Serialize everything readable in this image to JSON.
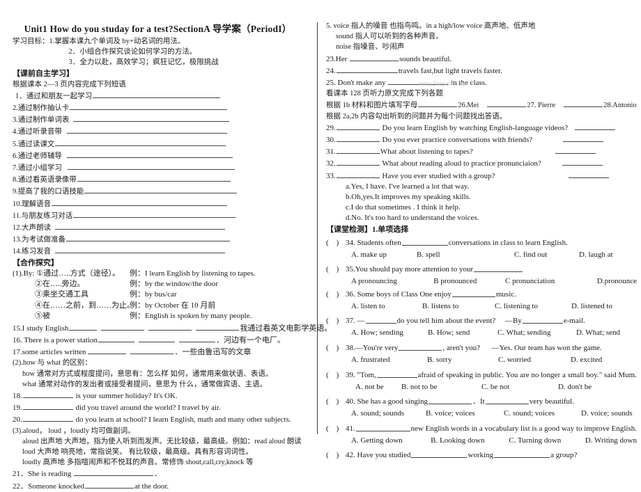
{
  "document": {
    "title": "Unit1 How do you studay for a test?SectionA 导学案（PeriodI）",
    "watermark": "www.1kejian.com"
  },
  "left_column": {
    "goal_label": "学习目标：",
    "goals": [
      "1.掌握本课九个单词及 by+动名词的用法。",
      "2．小组合作探究谈论如何学习的方法。",
      "3．全力以赴，高效学习；疯狂记忆，极限挑战"
    ],
    "section1_heading": "【课前自主学习】",
    "section1_intro": "根据课本 2—3 页内容完成下列短语",
    "phrases": [
      "1．通过和朋友一起学习",
      "2.通过制作抽认卡",
      "3.通过制作单词表",
      "4.通过听录音带",
      "5.通过读课文",
      "6.通过老师辅导",
      "7.通过小组学习",
      "8.通过看英语录像带",
      "9.提高了我的口语技能",
      "10.理解语音",
      "11.与朋友练习对话",
      "12.大声朗读",
      "13.为考试做准备",
      "14.练习发音"
    ],
    "section2_heading": "【合作探究】",
    "by_intro": "(1).By: ①通过…..方式（途径）。",
    "by_intro_example": "例：I learn English by listening to tapes.",
    "by_items": [
      {
        "cn": "②在…..旁边。",
        "ex": "例：by the window/the door"
      },
      {
        "cn": "③乘坐交通工具",
        "ex": "例：by bus/car"
      },
      {
        "cn": "④在……之前，到……为止。",
        "ex": "例：by October 在 10 月前"
      },
      {
        "cn": "⑤被",
        "ex": "例：English is spoken by many people."
      }
    ],
    "translate_items": [
      {
        "num": "15.",
        "en_a": "I study English",
        "en_b": "",
        "cn": "我通过看英文电影学英语。"
      },
      {
        "num": "16. ",
        "en_a": "There is a power station",
        "en_b": "．",
        "cn": "河边有一个电厂。"
      },
      {
        "num": "17.",
        "en_a": "some articles written",
        "en_b": "．",
        "cn": "一些由鲁迅写的文章"
      }
    ],
    "how_what_heading": "(2).how 与 what 的区别：",
    "how_what_lines": [
      "how 通常对方式或程度提问，意思有：怎么样 如何，通常用来做状语、表语。",
      "what 通常对动作的发出者或接受者提问，意思为 什么，通常做宾语、主语。"
    ],
    "how_what_questions": [
      {
        "num": "18.",
        "text": "is your summer holiday?    It's OK."
      },
      {
        "num": "19.",
        "text": "did you travel around the world?    I travel by air."
      },
      {
        "num": "20.",
        "text": "do you learn at school?    I learn English, math and many other subjects."
      }
    ],
    "aloud_heading": "(3).aloud，  loud ，loudly 均可做副词。",
    "aloud_lines": [
      "aloud 出声地 大声地，指为使人听到而发声。无比较级，最高级。例如：read aloud 朗读",
      "loud 大声地 响亮地，常指说笑。 有比较级，最高级。具有形容词词性。",
      "loudly 高声地 多指喧闹声和不悦耳的声音。常修饰 shout,call,cry,knock 等"
    ],
    "aloud_questions": [
      {
        "num": "21．",
        "pre": "She is reading ",
        "post": "．"
      },
      {
        "num": "22．",
        "pre": "Someone knocked",
        "post": "at the door."
      }
    ]
  },
  "right_column": {
    "voice_lines": [
      "5. voice 指人的噪音 也指鸟鸣。in a high/low voice 高声地、低声地",
      "sound 指人可以听到的各种声音。",
      "noise 指噪音、吵闹声"
    ],
    "voice_questions": [
      {
        "num": "23.Her ",
        "post": "sounds beautiful."
      },
      {
        "num": "24.",
        "post": "travels fast,but light travels faster."
      },
      {
        "num": "25. Don't make any ",
        "post": " in the class."
      }
    ],
    "listening_intro": "看课本 128 页听力原文完成下列各题",
    "names_line_label": "根据 1b 材料和图片填写字母",
    "names": [
      "26.Mei",
      "27. Pierre",
      "28.Antonio"
    ],
    "match_intro": "根据 2a,2b 内容勾出听到的问题并为每个问题找出答语。",
    "match_questions": [
      {
        "num": "29.",
        "text": "Do you learn English by watching English-language videos?"
      },
      {
        "num": "30.",
        "text": "Do you ever practice conversations with friends?"
      },
      {
        "num": "31.",
        "text": "What about listening to tapes?"
      },
      {
        "num": "32.",
        "text": "What about reading aloud to practice pronunciaion?"
      },
      {
        "num": "33.",
        "text": "Have you ever studied with a group?"
      }
    ],
    "match_answers": [
      "a.Yes, I have. I've learned a lot that way.",
      "b.Oh,yes.It improves my speaking skills.",
      "c.I do that sometimes . I think it help.",
      "d.No. It's too hard to understand the voices."
    ],
    "section3_heading": "【课堂检测】",
    "section3_subheading": "1.单项选择",
    "mcq": [
      {
        "num": "34.",
        "stem_pre": "Students often",
        "stem_post": "conversations in class to learn English.",
        "options": [
          "A. make up",
          "B. spell",
          "C. find out",
          "D. laugh at"
        ]
      },
      {
        "num": "35.",
        "stem_pre": "You should pay more attention to your",
        "stem_post": "",
        "options": [
          "A pronouncing",
          "B pronounced",
          "C pronunciation",
          "D.pronounce"
        ]
      },
      {
        "num": "36.",
        "stem_pre": "Some boys of Class One enjoy",
        "stem_post": "music.",
        "options": [
          "A. listen to",
          "B. listens to",
          "C. listening to",
          "D. listened to"
        ]
      },
      {
        "num": "37.",
        "stem_pre": "—",
        "stem_mid": "do you tell him about the event?",
        "stem_mid2": "—By",
        "stem_post": "e-mail.",
        "options": [
          "A. How; sending",
          "B. How; send",
          "C. What; sending",
          "D. What; send"
        ]
      },
      {
        "num": "38.",
        "stem_pre": "—You're very",
        "stem_post": ", aren't you?",
        "stem_tail": "—Yes. Our team has won the game.",
        "options": [
          "A. frustrated",
          "B. sorry",
          "C. worried",
          "D. excited"
        ]
      },
      {
        "num": "39.",
        "stem_pre": "\"Tom,",
        "stem_post": "afraid of speaking in public. You are no longer a small boy.\" said Mum.",
        "options": [
          "A. not be",
          "B. not to be",
          "C. be not",
          "D. don't be"
        ]
      },
      {
        "num": "40.",
        "stem_pre": "She has a good singing",
        "stem_mid": "．It",
        "stem_post": "very beautiful.",
        "options": [
          "A. sound; sounds",
          "B. voice; voices",
          "C. sound; voices",
          "D. voice; sounds"
        ]
      },
      {
        "num": "41.",
        "stem_pre": "",
        "stem_post": "new English words in a vocabulary list is a good way to improve English.",
        "options": [
          "A. Getting down",
          "B. Looking down",
          "C. Turning down",
          "D. Writing down"
        ]
      },
      {
        "num": "42.",
        "stem_pre": "Have you studied",
        "stem_mid": "working",
        "stem_post": "a group?",
        "options": []
      }
    ]
  }
}
